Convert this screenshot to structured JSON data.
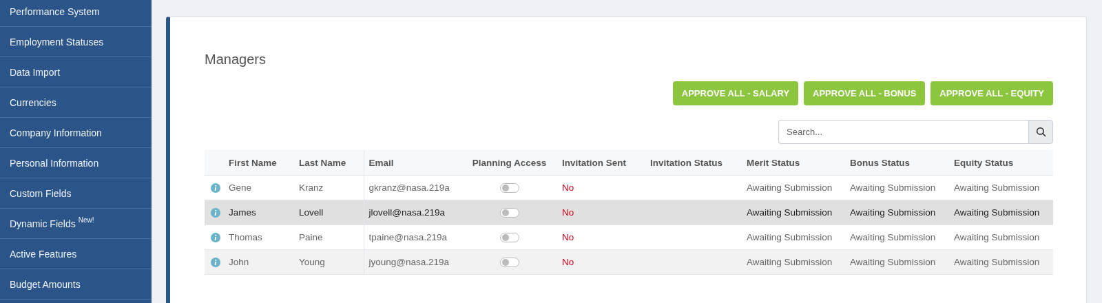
{
  "sidebar": {
    "items": [
      {
        "label": "Performance System"
      },
      {
        "label": "Employment Statuses"
      },
      {
        "label": "Data Import"
      },
      {
        "label": "Currencies"
      },
      {
        "label": "Company Information"
      },
      {
        "label": "Personal Information"
      },
      {
        "label": "Custom Fields"
      },
      {
        "label": "Dynamic Fields",
        "badge": "New!"
      },
      {
        "label": "Active Features"
      },
      {
        "label": "Budget Amounts"
      }
    ]
  },
  "card": {
    "title": "Managers",
    "buttons": [
      "APPROVE ALL - SALARY",
      "APPROVE ALL - BONUS",
      "APPROVE ALL - EQUITY"
    ],
    "search": {
      "placeholder": "Search..."
    },
    "table": {
      "columns": [
        "First Name",
        "Last Name",
        "Email",
        "Planning Access",
        "Invitation Sent",
        "Invitation Status",
        "Merit Status",
        "Bonus Status",
        "Equity Status"
      ],
      "rows": [
        {
          "first_name": "Gene",
          "last_name": "Kranz",
          "email": "gkranz@nasa.219a",
          "planning_access": false,
          "invitation_sent": "No",
          "merit_status": "Awaiting Submission",
          "bonus_status": "Awaiting Submission",
          "equity_status": "Awaiting Submission",
          "highlighted": false
        },
        {
          "first_name": "James",
          "last_name": "Lovell",
          "email": "jlovell@nasa.219a",
          "planning_access": false,
          "invitation_sent": "No",
          "merit_status": "Awaiting Submission",
          "bonus_status": "Awaiting Submission",
          "equity_status": "Awaiting Submission",
          "highlighted": true
        },
        {
          "first_name": "Thomas",
          "last_name": "Paine",
          "email": "tpaine@nasa.219a",
          "planning_access": false,
          "invitation_sent": "No",
          "merit_status": "Awaiting Submission",
          "bonus_status": "Awaiting Submission",
          "equity_status": "Awaiting Submission",
          "highlighted": false
        },
        {
          "first_name": "John",
          "last_name": "Young",
          "email": "jyoung@nasa.219a",
          "planning_access": false,
          "invitation_sent": "No",
          "merit_status": "Awaiting Submission",
          "bonus_status": "Awaiting Submission",
          "equity_status": "Awaiting Submission",
          "highlighted": false
        }
      ]
    }
  }
}
